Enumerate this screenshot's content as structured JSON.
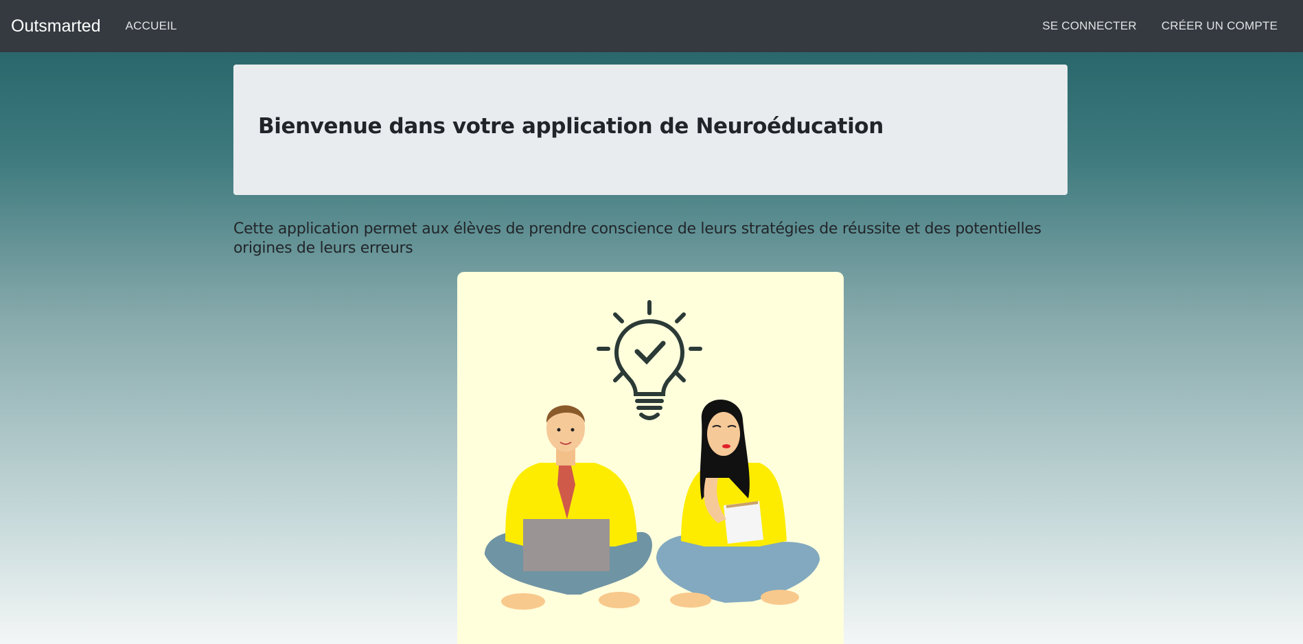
{
  "navbar": {
    "brand": "Outsmarted",
    "home_link": "ACCUEIL",
    "login_link": "SE CONNECTER",
    "signup_link": "CRÉER UN COMPTE"
  },
  "jumbotron": {
    "title": "Bienvenue dans votre application de Neuroéducation"
  },
  "intro": {
    "text": "Cette application permet aux élèves de prendre conscience de leurs stratégies de réussite et des potentielles origines de leurs erreurs"
  },
  "illustration": {
    "icon": "lightbulb-check-icon",
    "background_color": "#ffffdc",
    "shirt_color": "#fdec00",
    "jeans_color": "#6f94a4"
  }
}
